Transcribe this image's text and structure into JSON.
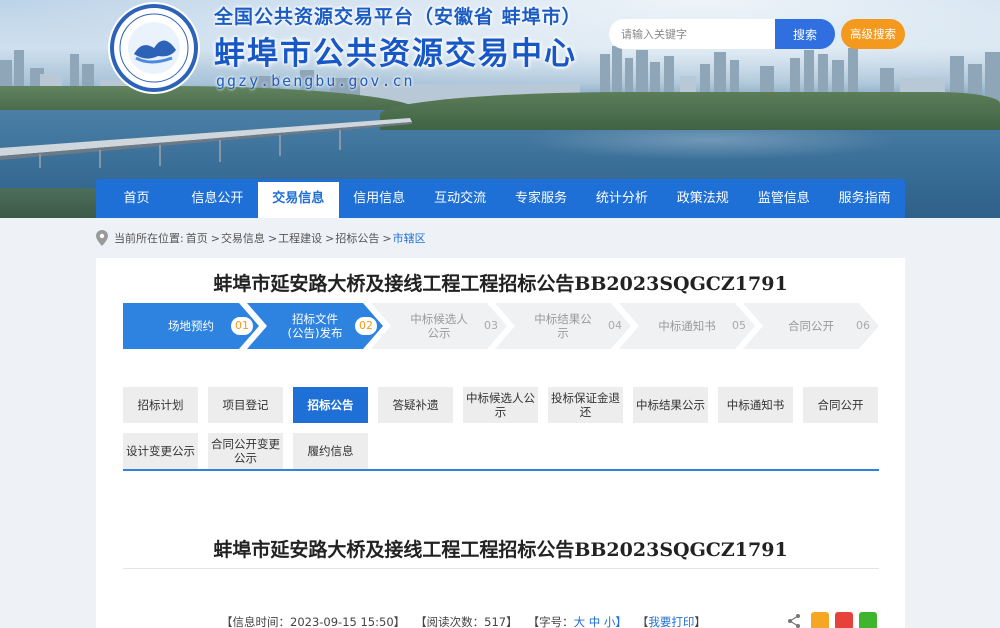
{
  "header": {
    "title_line1": "全国公共资源交易平台（安徽省 蚌埠市）",
    "title_line2": "蚌埠市公共资源交易中心",
    "domain": "ggzy.bengbu.gov.cn",
    "search": {
      "placeholder": "请输入关键字",
      "button_label": "搜索"
    },
    "advanced_search_label": "高级搜索"
  },
  "nav": {
    "items": [
      {
        "label": "首页"
      },
      {
        "label": "信息公开"
      },
      {
        "label": "交易信息",
        "active": true
      },
      {
        "label": "信用信息"
      },
      {
        "label": "互动交流"
      },
      {
        "label": "专家服务"
      },
      {
        "label": "统计分析"
      },
      {
        "label": "政策法规"
      },
      {
        "label": "监管信息"
      },
      {
        "label": "服务指南"
      }
    ]
  },
  "breadcrumb": {
    "prefix": "当前所在位置:",
    "items": [
      "首页",
      "交易信息",
      "工程建设",
      "招标公告",
      "市辖区"
    ],
    "separator": ">"
  },
  "document": {
    "title": "蚌埠市延安路大桥及接线工程工程招标公告BB2023SQGCZ1791",
    "meta": {
      "time_label": "【信息时间：",
      "time_value": "2023-09-15 15:50】",
      "views_label": "【阅读次数：",
      "views_value": "517】",
      "font_label": "【字号：",
      "font_large": "大",
      "font_medium": "中",
      "font_small": "小】",
      "print_open": "【",
      "print_label": "我要打印",
      "print_close": "】"
    }
  },
  "steps": [
    {
      "label": "场地预约",
      "num": "01",
      "done": true
    },
    {
      "label": "招标文件\n(公告)发布",
      "num": "02",
      "done": true
    },
    {
      "label": "中标候选人\n公示",
      "num": "03",
      "done": false
    },
    {
      "label": "中标结果公\n示",
      "num": "04",
      "done": false
    },
    {
      "label": "中标通知书",
      "num": "05",
      "done": false
    },
    {
      "label": "合同公开",
      "num": "06",
      "done": false
    }
  ],
  "tabs": [
    {
      "label": "招标计划"
    },
    {
      "label": "项目登记"
    },
    {
      "label": "招标公告",
      "active": true
    },
    {
      "label": "答疑补遗"
    },
    {
      "label": "中标候选人公示"
    },
    {
      "label": "投标保证金退还"
    },
    {
      "label": "中标结果公示"
    },
    {
      "label": "中标通知书"
    },
    {
      "label": "合同公开"
    },
    {
      "label": "设计变更公示"
    },
    {
      "label": "合同公开变更公示"
    },
    {
      "label": "履约信息"
    }
  ],
  "colors": {
    "primary": "#1e6fd6",
    "accent": "#f39a1e",
    "step_done": "#2f83e0"
  }
}
